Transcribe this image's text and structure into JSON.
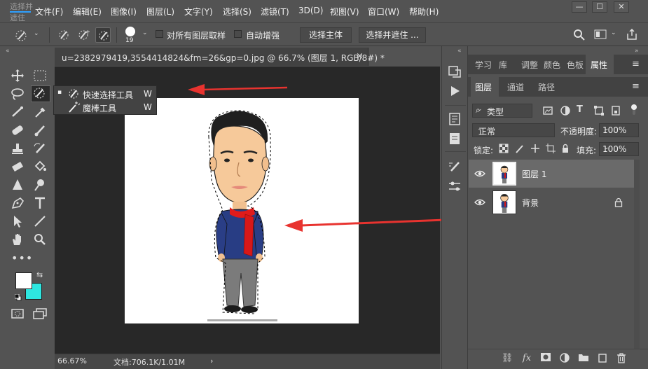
{
  "app": {
    "logo_text": "选择并遮住",
    "window_controls": [
      "—",
      "☐",
      "✕"
    ]
  },
  "menubar": {
    "items": [
      "文件(F)",
      "编辑(E)",
      "图像(I)",
      "图层(L)",
      "文字(Y)",
      "选择(S)",
      "滤镜(T)",
      "3D(D)",
      "视图(V)",
      "窗口(W)",
      "帮助(H)"
    ]
  },
  "options": {
    "brush_size": "19",
    "sample_all_layers": "对所有图层取样",
    "auto_enhance": "自动增强",
    "select_subject": "选择主体",
    "select_and_mask": "选择并遮住 ..."
  },
  "flyout": {
    "items": [
      {
        "label": "快速选择工具",
        "shortcut": "W"
      },
      {
        "label": "魔棒工具",
        "shortcut": "W"
      }
    ]
  },
  "document": {
    "tab_title": "u=2382979419,3554414824&fm=26&gp=0.jpg @ 66.7% (图层 1, RGB/8#) *",
    "close": "×"
  },
  "status": {
    "zoom": "66.67%",
    "doc_info": "文档:706.1K/1.01M",
    "more": "›"
  },
  "panels": {
    "top_tabs": [
      "学习",
      "库",
      "调整",
      "颜色",
      "色板",
      "属性"
    ],
    "layer_tabs": [
      "图层",
      "通道",
      "路径"
    ],
    "filter_kind": "类型",
    "blend_mode": "正常",
    "opacity_label": "不透明度:",
    "opacity_value": "100%",
    "lock_label": "锁定:",
    "fill_label": "填充:",
    "fill_value": "100%",
    "layers": [
      {
        "name": "图层 1",
        "visible": true,
        "selected": true,
        "locked": false
      },
      {
        "name": "背景",
        "visible": true,
        "selected": false,
        "locked": true
      }
    ]
  },
  "colors": {
    "foreground": "#ffffff",
    "background": "#2ee6e0",
    "arrow": "#e8332f"
  }
}
